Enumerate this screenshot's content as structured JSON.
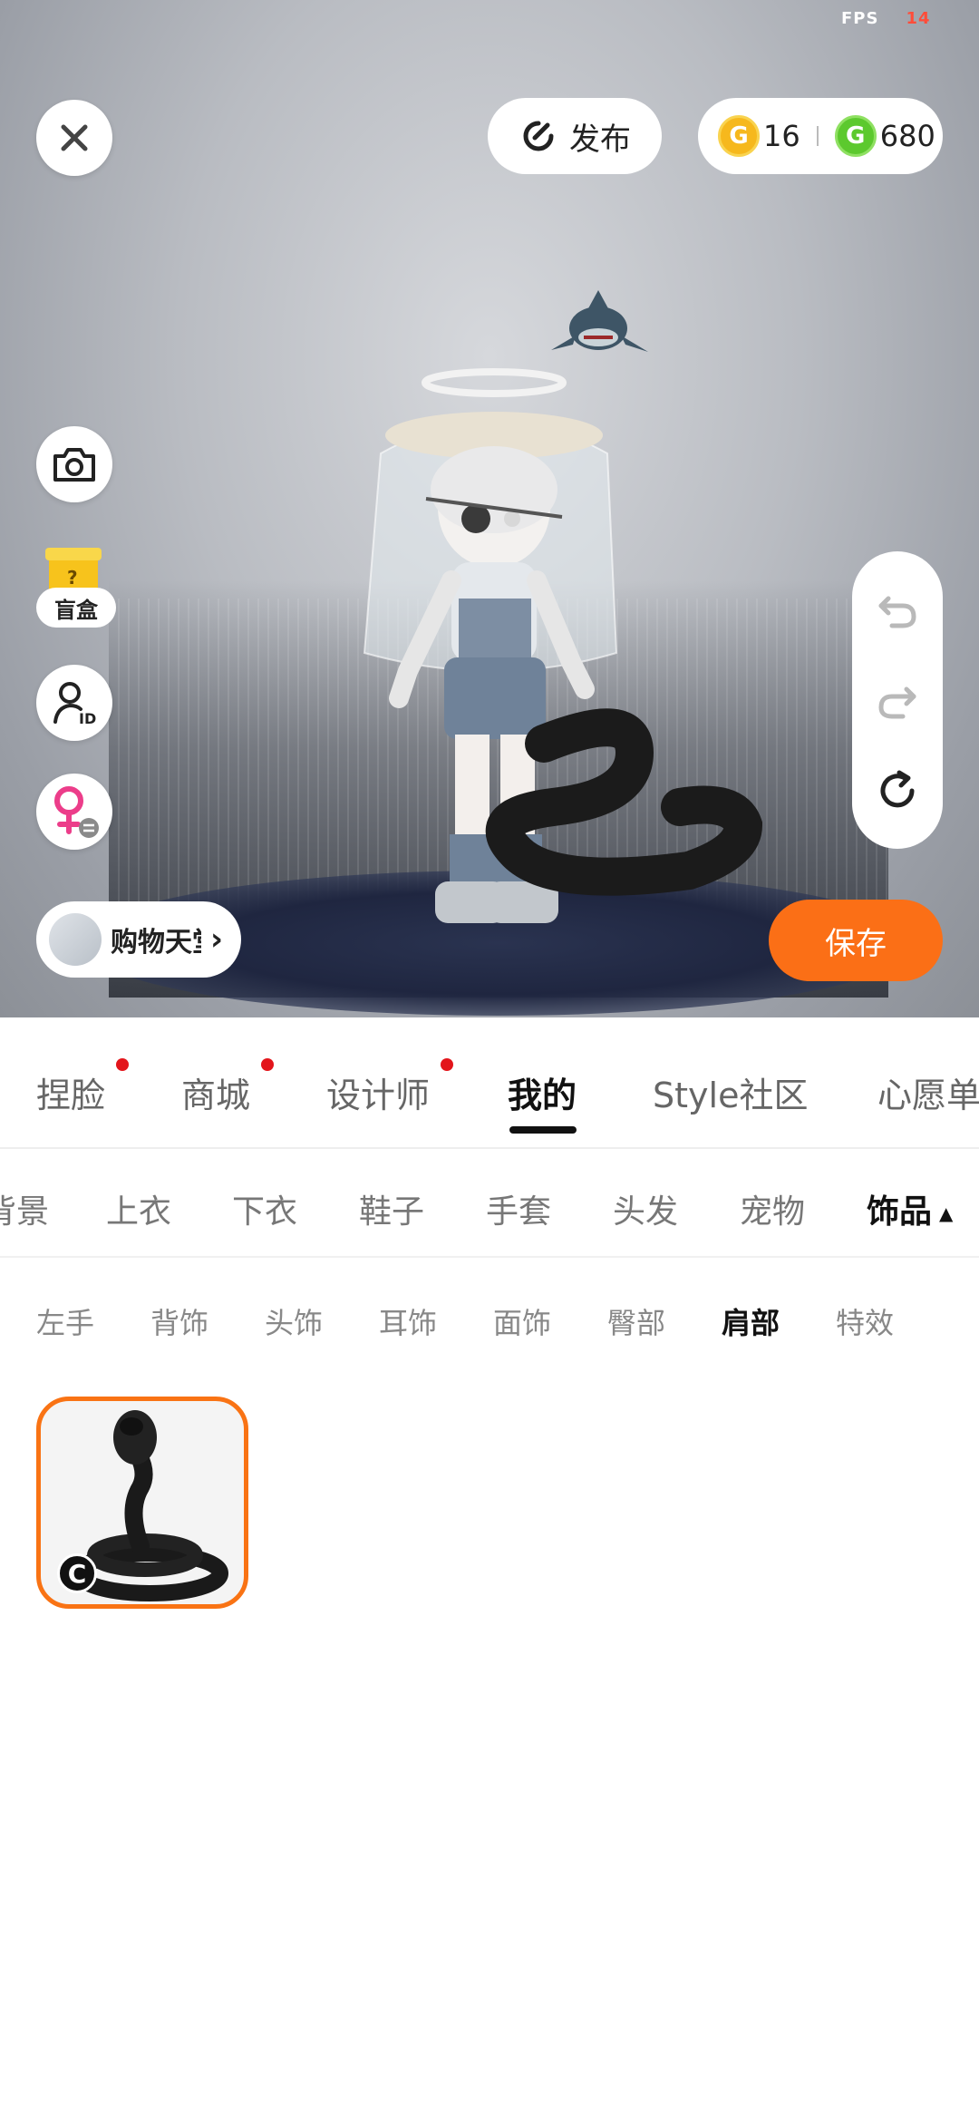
{
  "fps": {
    "label": "FPS",
    "value": "14"
  },
  "toolbar": {
    "publish_label": "发布"
  },
  "currency": {
    "gold_value": "16",
    "gold_symbol": "G",
    "green_value": "680",
    "green_symbol": "G"
  },
  "side": {
    "blindbox_label": "盲盒",
    "blindbox_mark": "?"
  },
  "shop": {
    "label": "购物天堂"
  },
  "actions": {
    "save_label": "保存"
  },
  "main_tabs": [
    {
      "label": "捏脸",
      "dot": true
    },
    {
      "label": "商城",
      "dot": true
    },
    {
      "label": "设计师",
      "dot": true
    },
    {
      "label": "我的",
      "dot": false,
      "active": true
    },
    {
      "label": "Style社区",
      "dot": false
    },
    {
      "label": "心愿单",
      "dot": false
    }
  ],
  "category_tabs": [
    {
      "label": "背景"
    },
    {
      "label": "上衣"
    },
    {
      "label": "下衣"
    },
    {
      "label": "鞋子"
    },
    {
      "label": "手套"
    },
    {
      "label": "头发"
    },
    {
      "label": "宠物"
    },
    {
      "label": "饰品",
      "active": true
    }
  ],
  "caret": "▲",
  "sub_tabs": [
    {
      "label": "左手"
    },
    {
      "label": "背饰"
    },
    {
      "label": "头饰"
    },
    {
      "label": "耳饰"
    },
    {
      "label": "面饰"
    },
    {
      "label": "臀部"
    },
    {
      "label": "肩部",
      "active": true
    },
    {
      "label": "特效"
    }
  ],
  "item": {
    "badge": "C",
    "name": "cobra-shoulder-accessory",
    "selected": true
  },
  "colors": {
    "accent": "#fb6f16",
    "dot": "#e3151b",
    "gold": "#f6b81d",
    "green": "#5cc92e"
  }
}
